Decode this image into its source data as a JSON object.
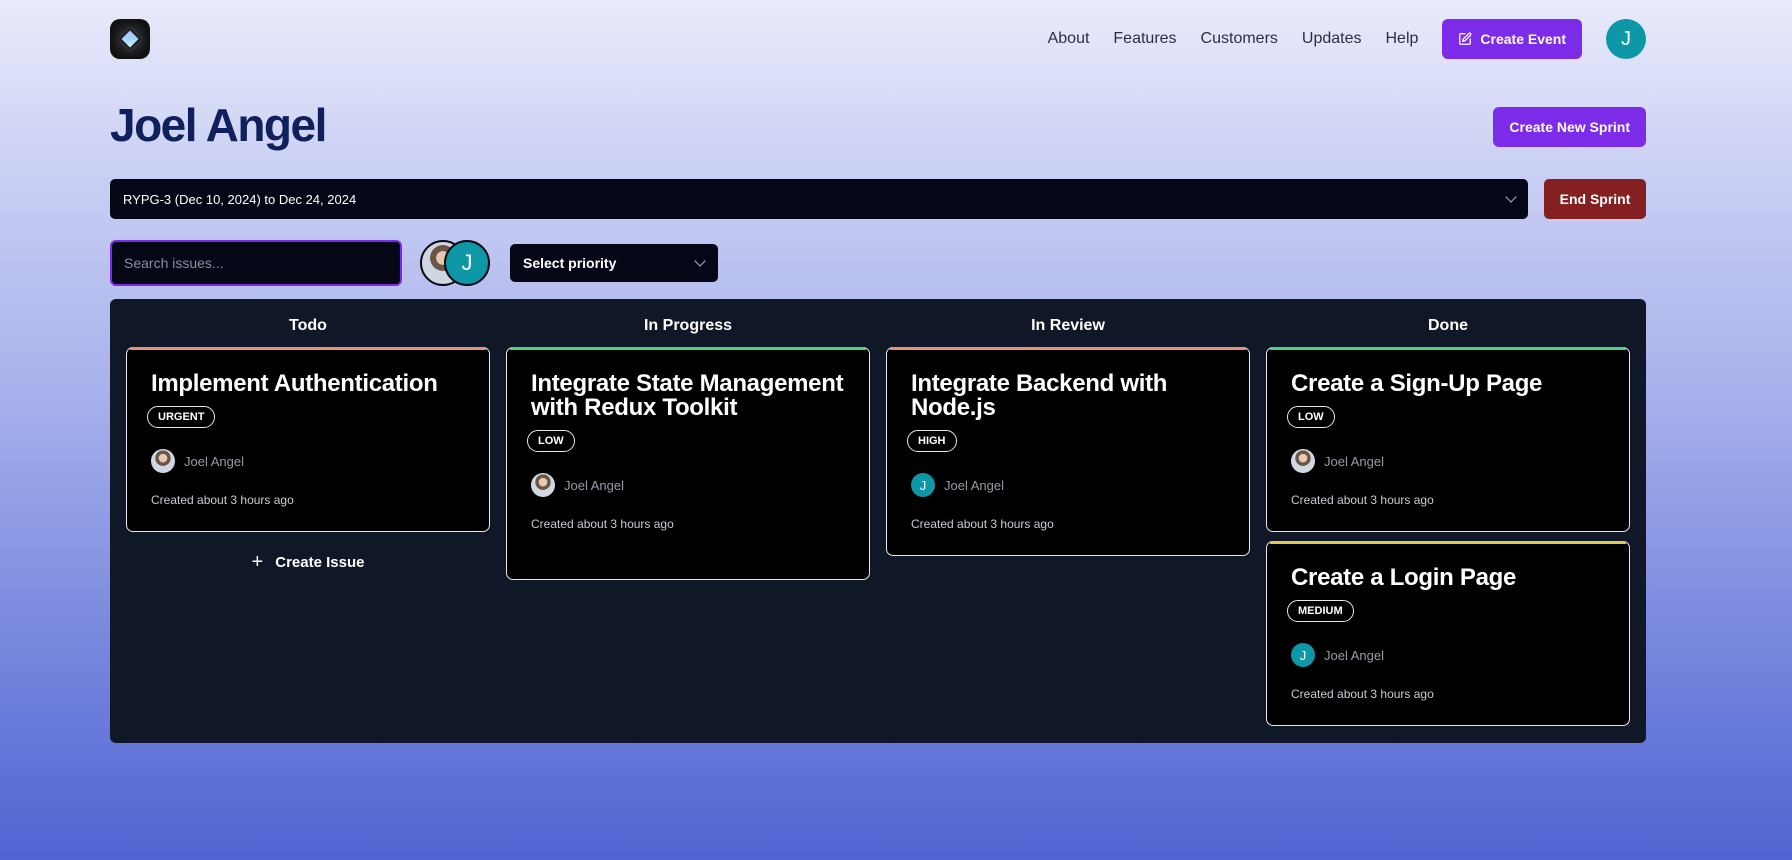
{
  "nav": {
    "links": [
      "About",
      "Features",
      "Customers",
      "Updates",
      "Help"
    ],
    "create_event": "Create Event",
    "avatar_initial": "J"
  },
  "project": {
    "title": "Joel Angel",
    "create_sprint": "Create New Sprint",
    "sprint_label": "RYPG-3 (Dec 10, 2024) to Dec 24, 2024",
    "end_sprint": "End Sprint"
  },
  "filters": {
    "search_placeholder": "Search issues...",
    "avatar_initial": "J",
    "priority_placeholder": "Select priority"
  },
  "colors": {
    "primary": "#7c2be8",
    "danger": "#841f22",
    "teal_avatar": "#0e97a7",
    "urgent": "#e8907a",
    "high": "#e8907a",
    "medium": "#e0c84a",
    "low": "#4fd08b"
  },
  "board": {
    "columns": [
      {
        "title": "Todo",
        "create_issue": "Create Issue",
        "cards": [
          {
            "title": "Implement Authentication",
            "priority": "URGENT",
            "assignee": "Joel Angel",
            "avatar": "photo",
            "created": "Created about 3 hours ago"
          }
        ]
      },
      {
        "title": "In Progress",
        "cards": [
          {
            "title": "Integrate State Management with Redux Toolkit",
            "priority": "LOW",
            "assignee": "Joel Angel",
            "avatar": "photo",
            "created": "Created about 3 hours ago"
          }
        ]
      },
      {
        "title": "In Review",
        "cards": [
          {
            "title": "Integrate Backend with Node.js",
            "priority": "HIGH",
            "assignee": "Joel Angel",
            "avatar": "J",
            "created": "Created about 3 hours ago"
          }
        ]
      },
      {
        "title": "Done",
        "cards": [
          {
            "title": "Create a Sign-Up Page",
            "priority": "LOW",
            "assignee": "Joel Angel",
            "avatar": "photo",
            "created": "Created about 3 hours ago"
          },
          {
            "title": "Create a Login Page",
            "priority": "MEDIUM",
            "assignee": "Joel Angel",
            "avatar": "J",
            "created": "Created about 3 hours ago"
          }
        ]
      }
    ]
  }
}
